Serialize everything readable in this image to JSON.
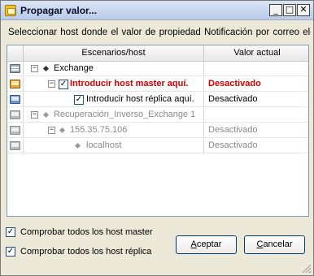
{
  "window": {
    "title": "Propagar valor...",
    "controls": {
      "minimize": "_",
      "maximize": "□",
      "close": "✕"
    }
  },
  "instruction": "Seleccionar host donde el valor de propiedad Notificación por correo elec",
  "grid": {
    "headers": {
      "scenarios": "Escenarios/host",
      "value": "Valor actual"
    },
    "rows": [
      {
        "name": "Exchange",
        "value": "",
        "icon": "grid-icon",
        "expander": "−",
        "checkbox": ""
      },
      {
        "name": "Introducir host master aquí.",
        "value": "Desactivado",
        "icon": "master-server-icon",
        "expander": "−",
        "checkbox": "✓"
      },
      {
        "name": "Introducir host réplica aquí.",
        "value": "Desactivado",
        "icon": "replica-server-icon",
        "expander": "",
        "checkbox": "✓"
      },
      {
        "name": "Recuperación_Inverso_Exchange 1",
        "value": "",
        "icon": "grid-icon",
        "expander": "−",
        "checkbox": ""
      },
      {
        "name": "155.35.75.106",
        "value": "Desactivado",
        "icon": "server-icon",
        "expander": "−",
        "checkbox": ""
      },
      {
        "name": "localhost",
        "value": "Desactivado",
        "icon": "server-icon",
        "expander": "",
        "checkbox": ""
      }
    ]
  },
  "options": {
    "check_all_master": {
      "label": "Comprobar todos los host master",
      "checked": "✓"
    },
    "check_all_replica": {
      "label": "Comprobar todos los host réplica",
      "checked": "✓"
    }
  },
  "buttons": {
    "accept": {
      "mnemonic": "A",
      "rest": "ceptar"
    },
    "cancel": {
      "mnemonic": "C",
      "rest": "ancelar"
    }
  },
  "colors": {
    "highlight_red": "#cc0000",
    "disabled_gray": "#8a8a8a",
    "border_blue": "#7f9db9"
  }
}
